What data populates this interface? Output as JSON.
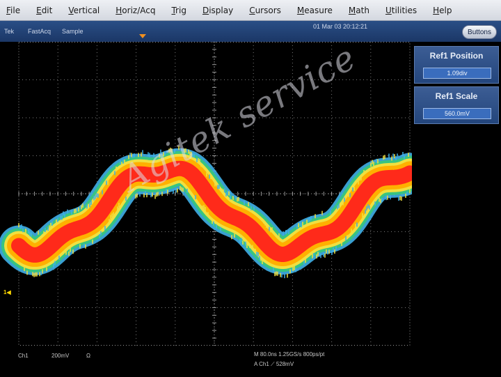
{
  "menu": [
    "File",
    "Edit",
    "Vertical",
    "Horiz/Acq",
    "Trig",
    "Display",
    "Cursors",
    "Measure",
    "Math",
    "Utilities",
    "Help"
  ],
  "status": {
    "mode1": "Tek",
    "mode2": "FastAcq",
    "mode3": "Sample",
    "datetime": "01 Mar 03 20:12:21",
    "buttons_label": "Buttons"
  },
  "panel": {
    "ref1_position": {
      "title": "Ref1 Position",
      "value": "1.09div"
    },
    "ref1_scale": {
      "title": "Ref1 Scale",
      "value": "560.0mV"
    }
  },
  "readout": {
    "channel": "Ch1",
    "scale": "200mV",
    "coupling": "Ω",
    "timebase": "M 80.0ns 1.25GS/s 800ps/pt",
    "trigger": "A Ch1 ⟋ 528mV"
  },
  "ground_marker": "1◀",
  "watermark": "Agitek service",
  "colors": {
    "trace_core": "#ff2a1a",
    "trace_mid": "#ffb000",
    "trace_edge": "#3fb0e8",
    "grid": "#9a9a9a",
    "menubar": "#dde1e8",
    "statusbar": "#1f3d70"
  },
  "icons": {
    "trigger_position": "trigger-position-icon",
    "ground_reference": "ground-reference-icon"
  }
}
